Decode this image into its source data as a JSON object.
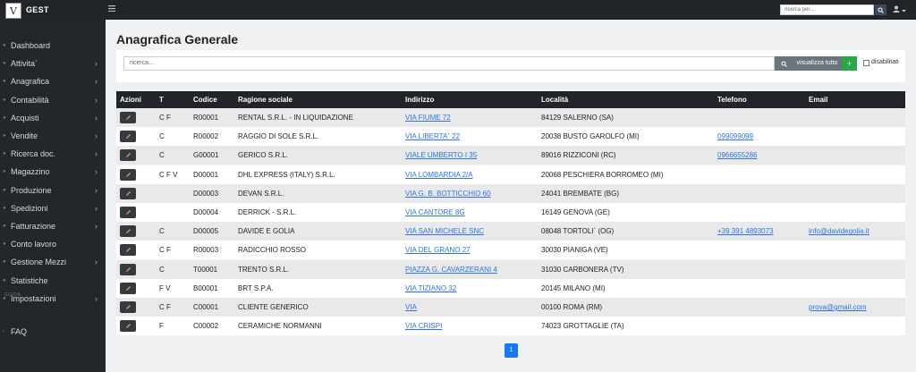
{
  "topbar": {
    "logo_text": "V",
    "brand": "GEST",
    "search_placeholder": "ricerca per...",
    "icons": [
      "menu-icon",
      "search-icon",
      "user-icon",
      "caret-down-icon"
    ]
  },
  "sidebar": {
    "items": [
      {
        "label": "Dashboard",
        "has_children": false
      },
      {
        "label": "Attivita`",
        "has_children": true
      },
      {
        "label": "Anagrafica",
        "has_children": true
      },
      {
        "label": "Contabilità",
        "has_children": true
      },
      {
        "label": "Acquisti",
        "has_children": true
      },
      {
        "label": "Vendite",
        "has_children": true
      },
      {
        "label": "Ricerca doc.",
        "has_children": true
      },
      {
        "label": "Magazzino",
        "has_children": true
      },
      {
        "label": "Produzione",
        "has_children": true
      },
      {
        "label": "Spedizioni",
        "has_children": true
      },
      {
        "label": "Fatturazione",
        "has_children": true
      },
      {
        "label": "Conto lavoro",
        "has_children": false
      },
      {
        "label": "Gestione Mezzi",
        "has_children": true
      },
      {
        "label": "Statistiche",
        "has_children": false
      },
      {
        "label": "Impostazioni",
        "has_children": true
      }
    ],
    "section_label": "GUIDA",
    "faq_label": "FAQ"
  },
  "main": {
    "title": "Anagrafica Generale",
    "search_placeholder": "ricerca...",
    "show_all_label": "visualizza tutto",
    "add_label": "+",
    "disabled_label": "disabilitati"
  },
  "table": {
    "headers": [
      "Azioni",
      "T",
      "Codice",
      "Ragione sociale",
      "Indirizzo",
      "Località",
      "Telefono",
      "Email"
    ],
    "rows": [
      {
        "t": "C F",
        "codice": "R00001",
        "ragione": "RENTAL S.R.L. - IN LIQUIDAZIONE",
        "indirizzo": "VIA FIUME 72",
        "localita": "84129 SALERNO (SA)",
        "telefono": "",
        "email": ""
      },
      {
        "t": "C",
        "codice": "R00002",
        "ragione": "RAGGIO DI SOLE S.R.L.",
        "indirizzo": "VIA LIBERTA` 22",
        "localita": "20038 BUSTO GAROLFO (MI)",
        "telefono": "099099099",
        "email": ""
      },
      {
        "t": "C",
        "codice": "G00001",
        "ragione": "GERICO S.R.L.",
        "indirizzo": "VIALE UMBERTO I 35",
        "localita": "89016 RIZZICONI (RC)",
        "telefono": "0966655286",
        "email": ""
      },
      {
        "t": "C F V",
        "codice": "D00001",
        "ragione": "DHL EXPRESS (ITALY) S.R.L.",
        "indirizzo": "VIA LOMBARDIA 2/A",
        "localita": "20068 PESCHIERA BORROMEO (MI)",
        "telefono": "",
        "email": ""
      },
      {
        "t": "",
        "codice": "D00003",
        "ragione": "DEVAN S.R.L.",
        "indirizzo": "VIA G. B. BOTTICCHIO 60",
        "localita": "24041 BREMBATE (BG)",
        "telefono": "",
        "email": ""
      },
      {
        "t": "",
        "codice": "D00004",
        "ragione": "DERRICK - S.R.L.",
        "indirizzo": "VIA CANTORE 8G",
        "localita": "16149 GENOVA (GE)",
        "telefono": "",
        "email": ""
      },
      {
        "t": "C",
        "codice": "D00005",
        "ragione": "DAVIDE E GOLIA",
        "indirizzo": "VIA SAN MICHELE SNC",
        "localita": "08048 TORTOLI` (OG)",
        "telefono": "+39 391 4893073",
        "email": "info@davidegolia.it"
      },
      {
        "t": "C F",
        "codice": "R00003",
        "ragione": "RADICCHIO ROSSO",
        "indirizzo": "VIA DEL GRANO 27",
        "localita": "30030 PIANIGA (VE)",
        "telefono": "",
        "email": ""
      },
      {
        "t": "C",
        "codice": "T00001",
        "ragione": "TRENTO S.R.L.",
        "indirizzo": "PIAZZA G. CAVARZERANI 4",
        "localita": "31030 CARBONERA (TV)",
        "telefono": "",
        "email": ""
      },
      {
        "t": "F V",
        "codice": "B00001",
        "ragione": "BRT S.P.A.",
        "indirizzo": "VIA TIZIANO 32",
        "localita": "20145 MILANO (MI)",
        "telefono": "",
        "email": ""
      },
      {
        "t": "C F",
        "codice": "C00001",
        "ragione": "CLIENTE GENERICO",
        "indirizzo": "VIA",
        "localita": "00100 ROMA (RM)",
        "telefono": "",
        "email": "prova@gmail.com"
      },
      {
        "t": "F",
        "codice": "C00002",
        "ragione": "CERAMICHE NORMANNI",
        "indirizzo": "VIA CRISPI",
        "localita": "74023 GROTTAGLIE (TA)",
        "telefono": "",
        "email": ""
      }
    ]
  },
  "pagination": {
    "current": "1"
  },
  "colors": {
    "topbar": "#212529",
    "sidebar": "#23272b",
    "link": "#2a73e8",
    "add_button": "#28a745",
    "page_active": "#1877f2"
  }
}
